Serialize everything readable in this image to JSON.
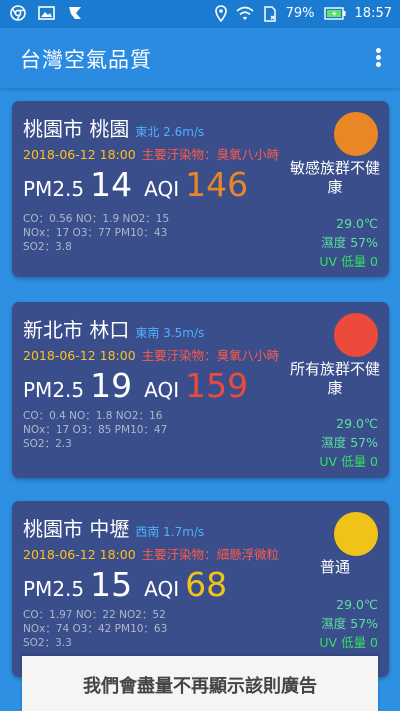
{
  "status_bar": {
    "battery": "79%",
    "time": "18:57",
    "icons": [
      "chrome-icon",
      "image-icon",
      "app-notification-icon",
      "location-icon",
      "wifi-icon",
      "sim-icon",
      "battery-icon"
    ]
  },
  "app": {
    "title": "台灣空氣品質"
  },
  "stations": [
    {
      "name": "桃園市 桃園",
      "wind": "東北 2.6m/s",
      "time": "2018-06-12 18:00",
      "pollutant": "主要汙染物：臭氧八小時",
      "pm_label": "PM2.5",
      "pm_value": "14",
      "aqi_label": "AQI",
      "aqi_value": "146",
      "gas_line1": "CO：0.56 NO：1.9 NO2：15",
      "gas_line2": "NOx：17 O3：77 PM10：43",
      "gas_line3": "SO2：3.8",
      "level": "敏感族群不健康",
      "temp": "29.0℃",
      "humidity": "濕度 57%",
      "uv": "UV 低量 0",
      "color": "#e98626"
    },
    {
      "name": "新北市 林口",
      "wind": "東南 3.5m/s",
      "time": "2018-06-12 18:00",
      "pollutant": "主要汙染物：臭氧八小時",
      "pm_label": "PM2.5",
      "pm_value": "19",
      "aqi_label": "AQI",
      "aqi_value": "159",
      "gas_line1": "CO：0.4 NO：1.8 NO2：16",
      "gas_line2": "NOx：17 O3：85 PM10：47",
      "gas_line3": "SO2：2.3",
      "level": "所有族群不健康",
      "temp": "29.0℃",
      "humidity": "濕度 57%",
      "uv": "UV 低量 0",
      "color": "#ec4b3c"
    },
    {
      "name": "桃園市 中壢",
      "wind": "西南 1.7m/s",
      "time": "2018-06-12 18:00",
      "pollutant": "主要汙染物：細懸浮微粒",
      "pm_label": "PM2.5",
      "pm_value": "15",
      "aqi_label": "AQI",
      "aqi_value": "68",
      "gas_line1": "CO：1.97 NO：22 NO2：52",
      "gas_line2": "NOx：74 O3：42 PM10：63",
      "gas_line3": "SO2：3.3",
      "level": "普通",
      "temp": "29.0℃",
      "humidity": "濕度 57%",
      "uv": "UV 低量 0",
      "color": "#f0c319"
    }
  ],
  "ad": {
    "text": "我們會盡量不再顯示該則廣告"
  }
}
